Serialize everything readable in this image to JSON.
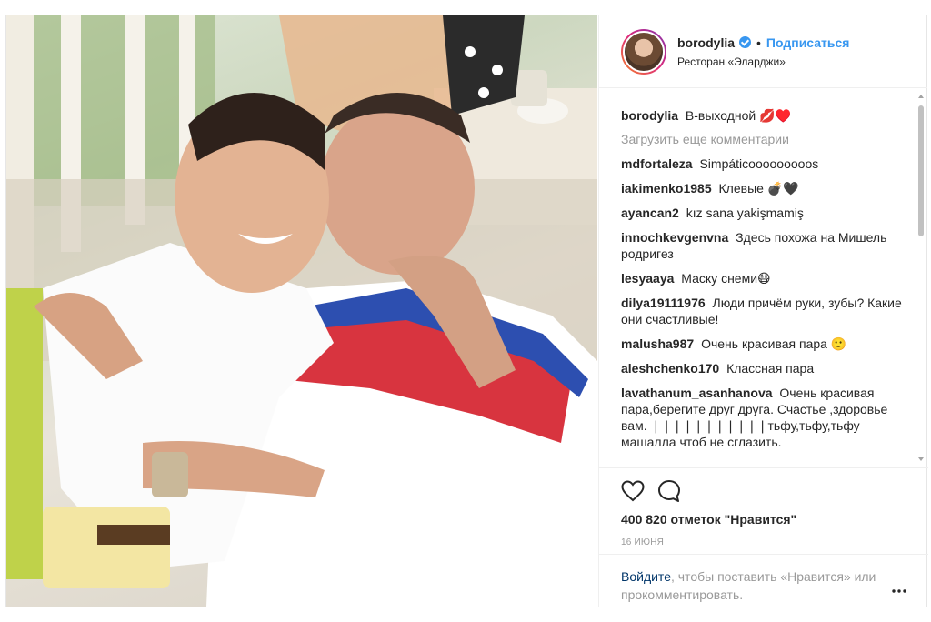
{
  "post": {
    "username": "borodylia",
    "follow_label": "Подписаться",
    "location": "Ресторан «Эларджи»",
    "separator": "•"
  },
  "comments": {
    "caption": {
      "user": "borodylia",
      "text": "В-выходной 💋♥️"
    },
    "load_more": "Загрузить еще комментарии",
    "items": [
      {
        "user": "mdfortaleza",
        "text": "Simpáticooooooooos"
      },
      {
        "user": "iakimenko1985",
        "text": "Клевые 💣🖤"
      },
      {
        "user": "ayancan2",
        "text": "kız sana yakişmamiş"
      },
      {
        "user": "innochkevgenvna",
        "text": "Здесь похожа на Мишель родригез"
      },
      {
        "user": "lesyaaya",
        "text": "Маску снеми😷"
      },
      {
        "user": "dilya19111976",
        "text": "Люди причём руки, зубы? Какие они счастливые!"
      },
      {
        "user": "malusha987",
        "text": "Очень красивая пара 🙂"
      },
      {
        "user": "aleshchenko170",
        "text": "Классная пара"
      },
      {
        "user": "lavathanum_asanhanova",
        "text": "Очень красивая пара,берегите друг друга. Счастье ,здоровье вам. ❘❘❘❘❘❘❘❘❘❘❘тьфу,тьфу,тьфу машалла чтоб не сглазить."
      }
    ]
  },
  "actions": {
    "likes": "400 820 отметок \"Нравится\"",
    "date": "16 ИЮНЯ"
  },
  "login": {
    "link": "Войдите",
    "text": ", чтобы поставить «Нравится» или прокомментировать."
  },
  "icons": {
    "like": "heart-icon",
    "comment": "comment-icon",
    "more": "more-options-icon",
    "verified": "verified-badge-icon"
  },
  "colors": {
    "accent_blue": "#3897f0",
    "login_link": "#003569",
    "muted": "#999999",
    "text": "#262626"
  }
}
